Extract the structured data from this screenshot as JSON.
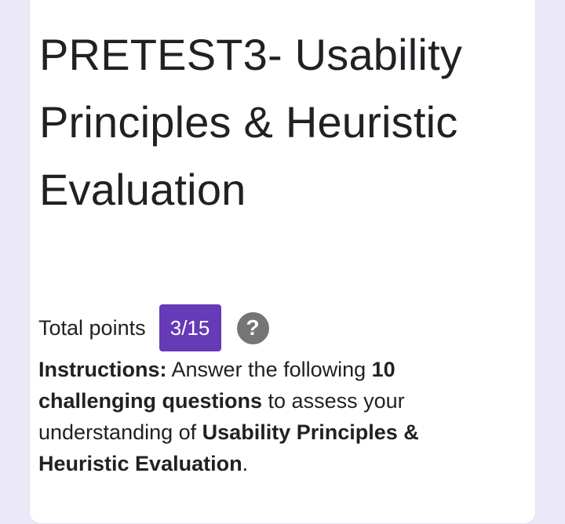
{
  "form": {
    "title": "PRETEST3- Usability Principles & Heuristic Evaluation",
    "total_points_label": "Total points",
    "score": "3/15",
    "help_icon": "question-mark-icon",
    "instructions": {
      "label": "Instructions:",
      "text1": " Answer the following ",
      "bold1": "10 challenging questions",
      "text2": " to assess your understanding of ",
      "bold2": "Usability Principles & Heuristic Evaluation",
      "text3": "."
    }
  },
  "colors": {
    "page_background": "#ebe8f7",
    "score_badge": "#673ab7",
    "help_icon": "#757575"
  }
}
